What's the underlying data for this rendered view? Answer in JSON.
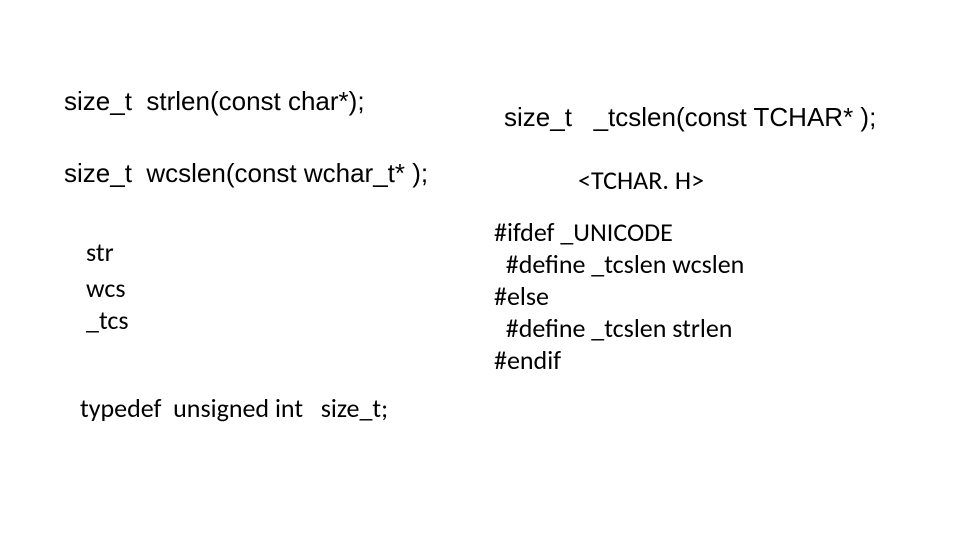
{
  "left": {
    "sig1": "size_t  strlen(const char*);",
    "sig2": "size_t  wcslen(const wchar_t* );",
    "prefixes": {
      "p1": "str",
      "p2": "wcs",
      "p3": "_tcs"
    },
    "typedef": "typedef  unsigned int   size_t;"
  },
  "right": {
    "sig": "size_t   _tcslen(const TCHAR* );",
    "header": "<TCHAR. H>",
    "code": {
      "l1": "#ifdef _UNICODE",
      "l2": "  #define _tcslen wcslen",
      "l3": "#else",
      "l4": "  #define _tcslen strlen",
      "l5": "#endif"
    }
  }
}
